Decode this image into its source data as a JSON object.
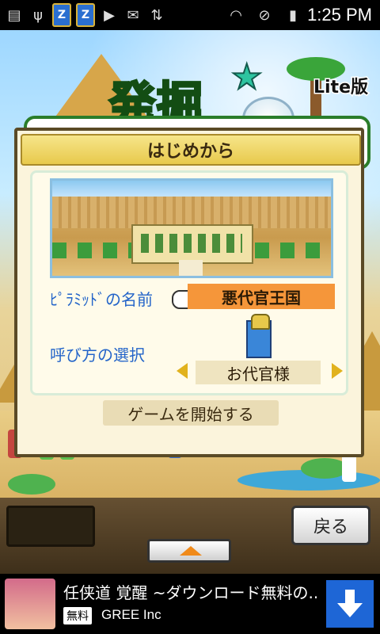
{
  "status_bar": {
    "time": "1:25 PM",
    "icons": [
      "storage-icon",
      "usb-icon",
      "app-z-icon",
      "app-z-icon",
      "play-store-icon",
      "gmail-icon",
      "signal-sync-icon",
      "wifi-icon",
      "no-sim-icon",
      "battery-charging-icon"
    ]
  },
  "game": {
    "logo_text": "発掘",
    "edition_label": "Lite版"
  },
  "dialog": {
    "title": "はじめから",
    "pyramid_name_label": "ﾋﾟﾗﾐｯﾄﾞの名前",
    "pyramid_name_value": "悪代官王国",
    "call_label": "呼び方の選択",
    "call_value": "お代官様",
    "start_label": "ゲームを開始する"
  },
  "controls": {
    "back_label": "戻る"
  },
  "ad": {
    "title": "任侠道 覚醒 ~ダウンロード無料の...",
    "tag": "無料",
    "source": "GREE Inc"
  },
  "colors": {
    "dialog_title_bg": "#e8c94c",
    "name_value_bg": "#f5963a",
    "label_blue": "#2364c9",
    "ad_download_bg": "#1e66d6"
  }
}
